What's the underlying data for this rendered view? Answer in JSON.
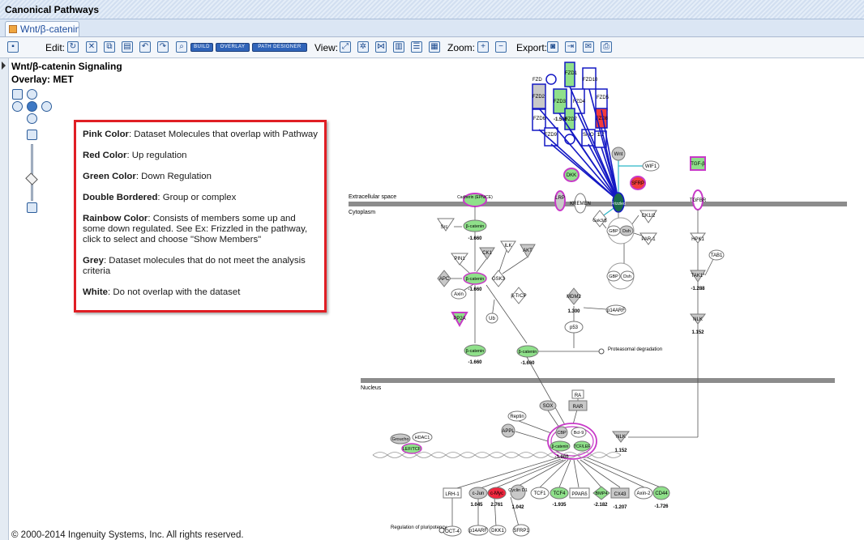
{
  "window": {
    "title": "Canonical Pathways"
  },
  "tab": {
    "label": "Wnt/β-catenin Signaling",
    "display_label": "Wnt/β-catenin..."
  },
  "toolbar": {
    "edit_label": "Edit:",
    "view_label": "View:",
    "zoom_label": "Zoom:",
    "export_label": "Export:",
    "build_label": "BUILD",
    "overlay_label": "OVERLAY",
    "path_designer_label": "PATH DESIGNER"
  },
  "pathway": {
    "title": "Wnt/β-catenin Signaling",
    "overlay": "Overlay: MET"
  },
  "legend": {
    "items": [
      {
        "term": "Pink Color",
        "desc": ": Dataset Molecules that overlap with Pathway"
      },
      {
        "term": "Red Color",
        "desc": ": Up regulation"
      },
      {
        "term": "Green Color",
        "desc": ": Down Regulation"
      },
      {
        "term": "Double Bordered",
        "desc": ": Group or complex"
      },
      {
        "term": "Rainbow Color",
        "desc": ": Consists of members some up and some down regulated.  See Ex: Frizzled in the pathway, click to select and choose \"Show Members\""
      },
      {
        "term": "Grey",
        "desc": ": Dataset molecules that do not meet the analysis criteria"
      },
      {
        "term": "White",
        "desc": ": Do not overlap with the dataset"
      }
    ]
  },
  "regions": {
    "extracellular": "Extracellular space",
    "cytoplasm": "Cytoplasm",
    "nucleus": "Nucleus"
  },
  "nodes": {
    "fzd_group": [
      "FZD",
      "FZD1",
      "FZD10",
      "FZD2",
      "FZD3",
      "FZD4",
      "FZD5",
      "FZD6",
      "FZD7",
      "FZD8",
      "FZD9",
      "SMO"
    ],
    "fzd_values": [
      "-1.560",
      "1.7"
    ],
    "wnt": "Wnt",
    "wif1": "WIF1",
    "dkk": "DKK",
    "sfrp": "SFRP",
    "tgfb": "TGF-β",
    "tgfbr": "TGFBR",
    "cadherin": "Cadherin (EPN/CE)",
    "lrp": "LRP",
    "kremen": "KREMEN",
    "frizzled": "Frizzled",
    "src": "Src",
    "bcatenin_membrane": "β-catenin",
    "bcatenin_membrane_value": "-1.660",
    "gsk3_top": "Gsk3/β",
    "ck1_2": "CK1/2",
    "gbp_dsh_1": [
      "GBP",
      "Dsh"
    ],
    "par1": "PAR-1",
    "hpk1": "HPK1",
    "tab1": "TAB1",
    "tak1": "TAK1*",
    "tak1_value": "-1.288",
    "nlk_cyto": "NLK",
    "nlk_cyto_value": "1.152",
    "pin1": "PIN1",
    "ck1": "CK1",
    "ilk": "ILK",
    "akt": "AKT",
    "apc": "APC",
    "bcatenin_complex": "β-catenin",
    "bcatenin_complex_value": "-1.660",
    "gsk3": "GSK3",
    "gbp_dsh_2": [
      "GBP",
      "Dsh"
    ],
    "axin": "Axin",
    "btrcp": "β-TrCP",
    "mdm2": "MDM2",
    "mdm2_value": "1.300",
    "p14arf_cyto": "p14ARF",
    "pp2a": "PP2A",
    "ub": "Ub",
    "p53": "p53",
    "bcatenin_free": "β-catenin",
    "bcatenin_free_value": "-1.660",
    "bcatenin_degr": "β-catenin",
    "bcatenin_degr_value": "-1.660",
    "proteasomal": "Proteasomal degradation",
    "ra": "RA",
    "rar": "RAR",
    "sox": "SOX",
    "reptin": "Reptin",
    "appl": "APPL",
    "cbp": "CBP",
    "bcl9": "Bcl-9",
    "bcatenin_nuc": "β-catenin",
    "tcf_lef": "TCF/LEF",
    "nuc_value": "-1.660",
    "nlk_nuc": "NLK",
    "nlk_nuc_value": "1.152",
    "groucho": "Groucho",
    "hdac1": "HDAC1",
    "lef_tcf": "LEF/TCF",
    "targets": [
      "LRH-1",
      "c-Jun",
      "c-Myc",
      "Cyclin D1",
      "TCF1",
      "TCF4",
      "PPARδ",
      "BMP4",
      "CX43",
      "Axin-2",
      "CD44"
    ],
    "target_values": [
      "1.045",
      "2.761",
      "1.042",
      "-1.935",
      "-2.182",
      "-1.207",
      "-1.726"
    ],
    "oct4": "OCT-4",
    "p14arf_nuc": "p14ARF",
    "dkk1": "DKK1",
    "sfrp1": "SFRP1",
    "regulation": "Regulation of pluripotency"
  },
  "footer": {
    "copyright": "© 2000-2014 Ingenuity Systems, Inc. All rights reserved."
  },
  "colors": {
    "down_green": "#8fe08a",
    "up_red": "#f23c3c",
    "overlap_pink": "#c839c8",
    "grey": "#c8c8c8",
    "fzd_blue": "#1418c4",
    "legend_border": "#e01e24"
  }
}
